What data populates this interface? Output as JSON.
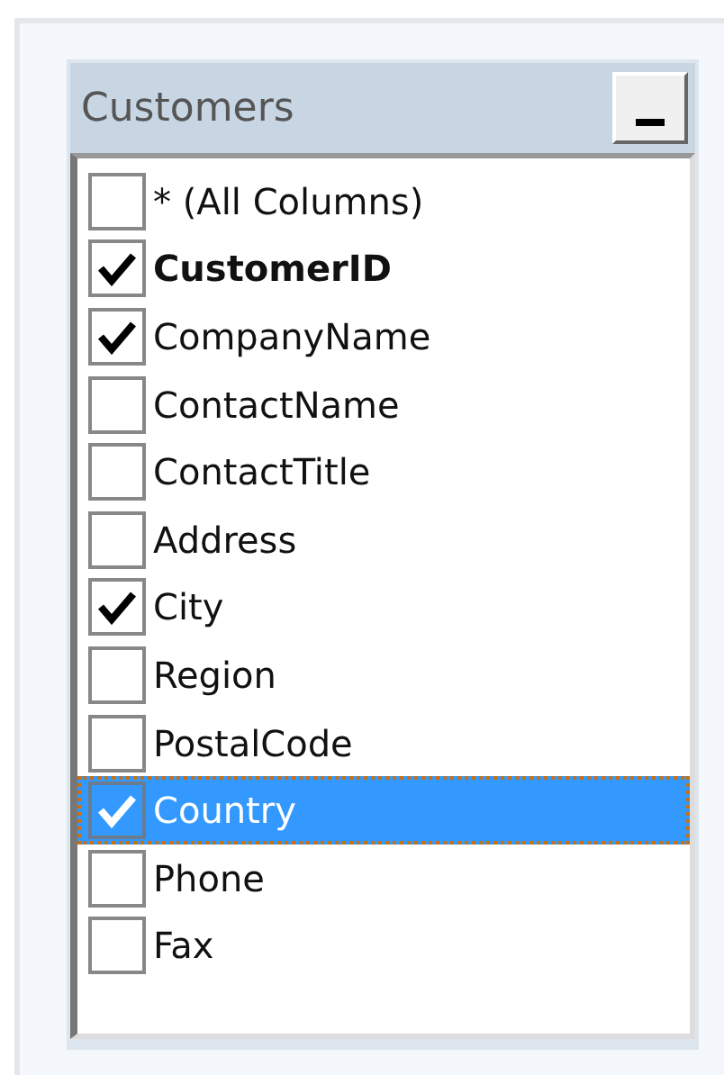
{
  "table_window": {
    "title": "Customers",
    "columns": [
      {
        "name": "* (All Columns)",
        "checked": false,
        "selected": false,
        "primary_key": false
      },
      {
        "name": "CustomerID",
        "checked": true,
        "selected": false,
        "primary_key": true
      },
      {
        "name": "CompanyName",
        "checked": true,
        "selected": false,
        "primary_key": false
      },
      {
        "name": "ContactName",
        "checked": false,
        "selected": false,
        "primary_key": false
      },
      {
        "name": "ContactTitle",
        "checked": false,
        "selected": false,
        "primary_key": false
      },
      {
        "name": "Address",
        "checked": false,
        "selected": false,
        "primary_key": false
      },
      {
        "name": "City",
        "checked": true,
        "selected": false,
        "primary_key": false
      },
      {
        "name": "Region",
        "checked": false,
        "selected": false,
        "primary_key": false
      },
      {
        "name": "PostalCode",
        "checked": false,
        "selected": false,
        "primary_key": false
      },
      {
        "name": "Country",
        "checked": true,
        "selected": true,
        "primary_key": false
      },
      {
        "name": "Phone",
        "checked": false,
        "selected": false,
        "primary_key": false
      },
      {
        "name": "Fax",
        "checked": false,
        "selected": false,
        "primary_key": false
      }
    ]
  }
}
